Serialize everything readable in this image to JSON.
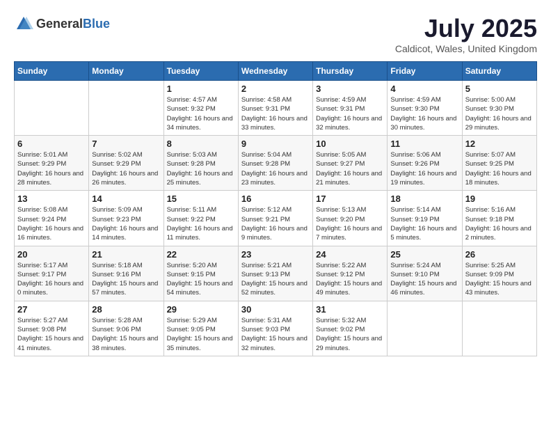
{
  "logo": {
    "general": "General",
    "blue": "Blue"
  },
  "title": "July 2025",
  "subtitle": "Caldicot, Wales, United Kingdom",
  "headers": [
    "Sunday",
    "Monday",
    "Tuesday",
    "Wednesday",
    "Thursday",
    "Friday",
    "Saturday"
  ],
  "weeks": [
    [
      {
        "day": "",
        "info": ""
      },
      {
        "day": "",
        "info": ""
      },
      {
        "day": "1",
        "info": "Sunrise: 4:57 AM\nSunset: 9:32 PM\nDaylight: 16 hours\nand 34 minutes."
      },
      {
        "day": "2",
        "info": "Sunrise: 4:58 AM\nSunset: 9:31 PM\nDaylight: 16 hours\nand 33 minutes."
      },
      {
        "day": "3",
        "info": "Sunrise: 4:59 AM\nSunset: 9:31 PM\nDaylight: 16 hours\nand 32 minutes."
      },
      {
        "day": "4",
        "info": "Sunrise: 4:59 AM\nSunset: 9:30 PM\nDaylight: 16 hours\nand 30 minutes."
      },
      {
        "day": "5",
        "info": "Sunrise: 5:00 AM\nSunset: 9:30 PM\nDaylight: 16 hours\nand 29 minutes."
      }
    ],
    [
      {
        "day": "6",
        "info": "Sunrise: 5:01 AM\nSunset: 9:29 PM\nDaylight: 16 hours\nand 28 minutes."
      },
      {
        "day": "7",
        "info": "Sunrise: 5:02 AM\nSunset: 9:29 PM\nDaylight: 16 hours\nand 26 minutes."
      },
      {
        "day": "8",
        "info": "Sunrise: 5:03 AM\nSunset: 9:28 PM\nDaylight: 16 hours\nand 25 minutes."
      },
      {
        "day": "9",
        "info": "Sunrise: 5:04 AM\nSunset: 9:28 PM\nDaylight: 16 hours\nand 23 minutes."
      },
      {
        "day": "10",
        "info": "Sunrise: 5:05 AM\nSunset: 9:27 PM\nDaylight: 16 hours\nand 21 minutes."
      },
      {
        "day": "11",
        "info": "Sunrise: 5:06 AM\nSunset: 9:26 PM\nDaylight: 16 hours\nand 19 minutes."
      },
      {
        "day": "12",
        "info": "Sunrise: 5:07 AM\nSunset: 9:25 PM\nDaylight: 16 hours\nand 18 minutes."
      }
    ],
    [
      {
        "day": "13",
        "info": "Sunrise: 5:08 AM\nSunset: 9:24 PM\nDaylight: 16 hours\nand 16 minutes."
      },
      {
        "day": "14",
        "info": "Sunrise: 5:09 AM\nSunset: 9:23 PM\nDaylight: 16 hours\nand 14 minutes."
      },
      {
        "day": "15",
        "info": "Sunrise: 5:11 AM\nSunset: 9:22 PM\nDaylight: 16 hours\nand 11 minutes."
      },
      {
        "day": "16",
        "info": "Sunrise: 5:12 AM\nSunset: 9:21 PM\nDaylight: 16 hours\nand 9 minutes."
      },
      {
        "day": "17",
        "info": "Sunrise: 5:13 AM\nSunset: 9:20 PM\nDaylight: 16 hours\nand 7 minutes."
      },
      {
        "day": "18",
        "info": "Sunrise: 5:14 AM\nSunset: 9:19 PM\nDaylight: 16 hours\nand 5 minutes."
      },
      {
        "day": "19",
        "info": "Sunrise: 5:16 AM\nSunset: 9:18 PM\nDaylight: 16 hours\nand 2 minutes."
      }
    ],
    [
      {
        "day": "20",
        "info": "Sunrise: 5:17 AM\nSunset: 9:17 PM\nDaylight: 16 hours\nand 0 minutes."
      },
      {
        "day": "21",
        "info": "Sunrise: 5:18 AM\nSunset: 9:16 PM\nDaylight: 15 hours\nand 57 minutes."
      },
      {
        "day": "22",
        "info": "Sunrise: 5:20 AM\nSunset: 9:15 PM\nDaylight: 15 hours\nand 54 minutes."
      },
      {
        "day": "23",
        "info": "Sunrise: 5:21 AM\nSunset: 9:13 PM\nDaylight: 15 hours\nand 52 minutes."
      },
      {
        "day": "24",
        "info": "Sunrise: 5:22 AM\nSunset: 9:12 PM\nDaylight: 15 hours\nand 49 minutes."
      },
      {
        "day": "25",
        "info": "Sunrise: 5:24 AM\nSunset: 9:10 PM\nDaylight: 15 hours\nand 46 minutes."
      },
      {
        "day": "26",
        "info": "Sunrise: 5:25 AM\nSunset: 9:09 PM\nDaylight: 15 hours\nand 43 minutes."
      }
    ],
    [
      {
        "day": "27",
        "info": "Sunrise: 5:27 AM\nSunset: 9:08 PM\nDaylight: 15 hours\nand 41 minutes."
      },
      {
        "day": "28",
        "info": "Sunrise: 5:28 AM\nSunset: 9:06 PM\nDaylight: 15 hours\nand 38 minutes."
      },
      {
        "day": "29",
        "info": "Sunrise: 5:29 AM\nSunset: 9:05 PM\nDaylight: 15 hours\nand 35 minutes."
      },
      {
        "day": "30",
        "info": "Sunrise: 5:31 AM\nSunset: 9:03 PM\nDaylight: 15 hours\nand 32 minutes."
      },
      {
        "day": "31",
        "info": "Sunrise: 5:32 AM\nSunset: 9:02 PM\nDaylight: 15 hours\nand 29 minutes."
      },
      {
        "day": "",
        "info": ""
      },
      {
        "day": "",
        "info": ""
      }
    ]
  ]
}
